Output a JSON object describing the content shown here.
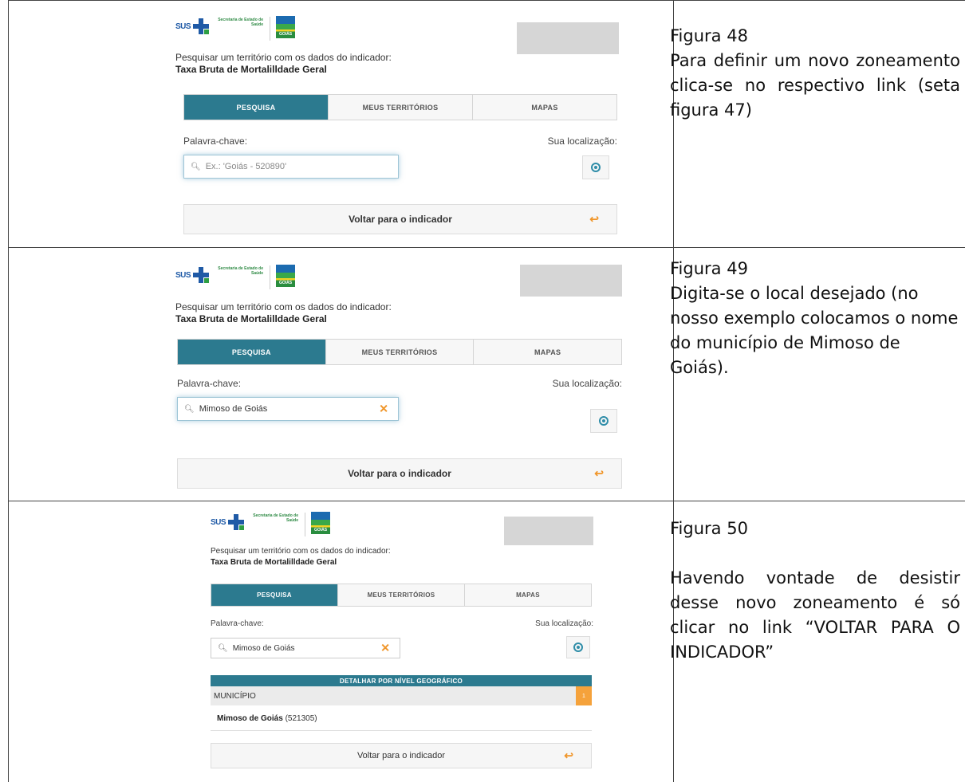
{
  "app": {
    "sus_logo_text": "SUS",
    "secretaria_text": "Secretaria de Estado de Saúde",
    "goias_flag_text": "GOIÁS",
    "prompt_text": "Pesquisar um território com os dados do indicador:",
    "indicator_title": "Taxa Bruta de Mortalilldade Geral",
    "tabs": [
      "PESQUISA",
      "MEUS TERRITÓRIOS",
      "MAPAS"
    ],
    "keyword_label": "Palavra-chave:",
    "location_label": "Sua localização:",
    "search_placeholder": "Ex.: 'Goiás - 520890'",
    "search_value": "Mimoso de Goiás",
    "back_label": "Voltar para o indicador",
    "detail_header": "DETALHAR POR NÍVEL GEOGRÁFICO",
    "level_label": "MUNICÍPIO",
    "level_count": "1",
    "result_name": "Mimoso de Goiás",
    "result_code": "(521305)"
  },
  "captions": {
    "fig48_title": "Figura 48",
    "fig48_text": "Para definir um novo zoneamento clica-se no respectivo link (seta figura 47)",
    "fig49_title": "Figura 49",
    "fig49_text": "Digita-se o local desejado (no nosso exemplo colocamos o nome do município de Mimoso de Goiás).",
    "fig50_title": "Figura 50",
    "fig50_text": "Havendo vontade de desistir desse novo zoneamento é só clicar no link “VOLTAR PARA O INDICADOR”"
  },
  "colors": {
    "accent": "#2c7a8f",
    "orange": "#f0962a",
    "grid": "#444444"
  }
}
